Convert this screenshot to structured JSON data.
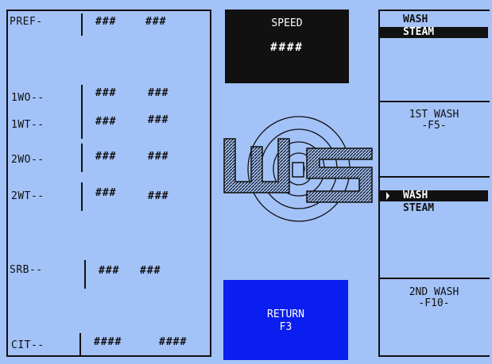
{
  "left_panel": {
    "rows": [
      {
        "label": "PREF-",
        "v1": "###",
        "v2": "###"
      },
      {
        "label": "1WO--",
        "v1": "###",
        "v2": "###"
      },
      {
        "label": "1WT--",
        "v1": "###",
        "v2": "###"
      },
      {
        "label": "2WO--",
        "v1": "###",
        "v2": "###"
      },
      {
        "label": "2WT--",
        "v1": "###",
        "v2": "###"
      },
      {
        "label": "SRB--",
        "v1": "###",
        "v2": "###"
      },
      {
        "label": "CIT--",
        "v1": "####",
        "v2": "####"
      }
    ]
  },
  "speed": {
    "title": "SPEED",
    "value": "####"
  },
  "return_button": {
    "line1": "RETURN",
    "line2": "F3"
  },
  "wash1": {
    "options": [
      "WASH",
      "STEAM"
    ],
    "selected": "STEAM",
    "caption_line1": "1ST WASH",
    "caption_line2": "-F5-"
  },
  "wash2": {
    "options": [
      "WASH",
      "STEAM"
    ],
    "selected": "WASH",
    "caption_line1": "2ND WASH",
    "caption_line2": "-F10-"
  },
  "colors": {
    "background": "#a3c2f8",
    "return_button": "#0a1ef0",
    "speed_box": "#111111"
  },
  "logo": {
    "text": "WS"
  }
}
